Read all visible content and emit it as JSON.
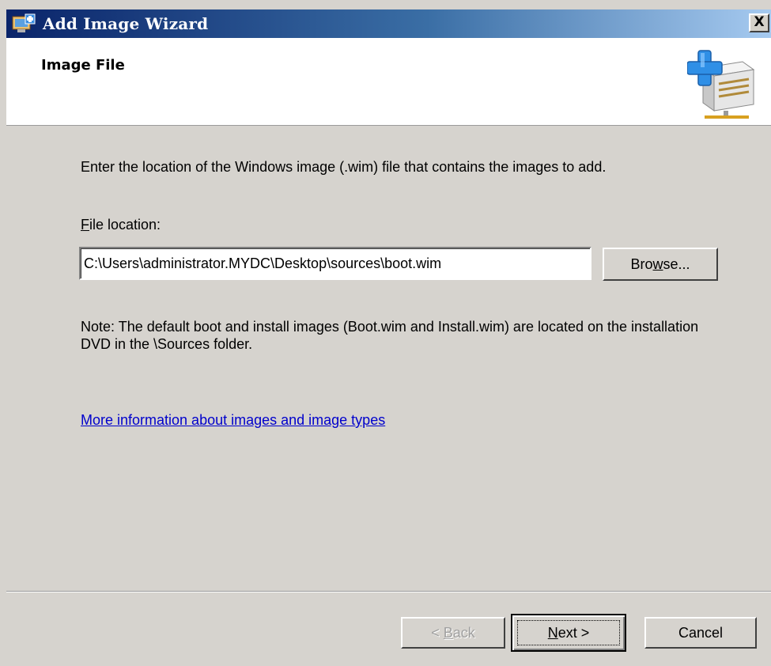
{
  "window": {
    "title": "Add Image Wizard",
    "close_label": "X"
  },
  "header": {
    "title": "Image File",
    "icon": "server-add-icon"
  },
  "body": {
    "instructions": "Enter the location of the Windows image (.wim) file that contains the images to add.",
    "file_label_accesskey": "F",
    "file_label_rest": "ile location:",
    "file_location_value": "C:\\Users\\administrator.MYDC\\Desktop\\sources\\boot.wim",
    "browse_accesskey": "w",
    "browse_prefix": "Bro",
    "browse_suffix": "se...",
    "note": "Note: The default boot and install images (Boot.wim and Install.wim) are located on the installation DVD in the \\Sources folder.",
    "more_info_link": "More information about images and image types"
  },
  "footer": {
    "back_prefix": "< ",
    "back_accesskey": "B",
    "back_suffix": "ack",
    "next_accesskey": "N",
    "next_suffix": "ext >",
    "cancel_label": "Cancel"
  },
  "colors": {
    "titlebar_start": "#0a246a",
    "titlebar_end": "#a6caf0",
    "dialog_background": "#d6d3ce",
    "link": "#0000cc"
  }
}
